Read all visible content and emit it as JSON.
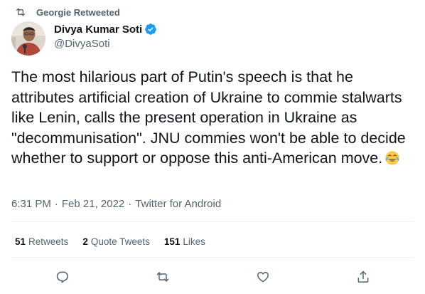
{
  "retweet_context": {
    "text": "Georgie Retweeted",
    "icon": "retweet-icon"
  },
  "author": {
    "name": "Divya Kumar Soti",
    "handle": "@DivyaSoti",
    "verified": true,
    "verified_color": "#1d9bf0"
  },
  "tweet": {
    "text": "The most hilarious part of Putin's speech is that he attributes artificial creation of Ukraine to commie stalwarts like Lenin, calls the present operation in Ukraine as \"decommunisation\". JNU commies won't be able to decide whether to support or oppose this anti-American move.",
    "emoji": "face-with-tears-of-joy"
  },
  "meta": {
    "time": "6:31 PM",
    "date": "Feb 21, 2022",
    "source": "Twitter for Android"
  },
  "stats": {
    "retweets_count": "51",
    "retweets_label": "Retweets",
    "quotes_count": "2",
    "quotes_label": "Quote Tweets",
    "likes_count": "151",
    "likes_label": "Likes"
  },
  "actions": [
    "reply-icon",
    "retweet-icon",
    "like-icon",
    "share-icon"
  ],
  "colors": {
    "text": "#0f1419",
    "secondary": "#536471",
    "divider": "#eff3f4"
  }
}
